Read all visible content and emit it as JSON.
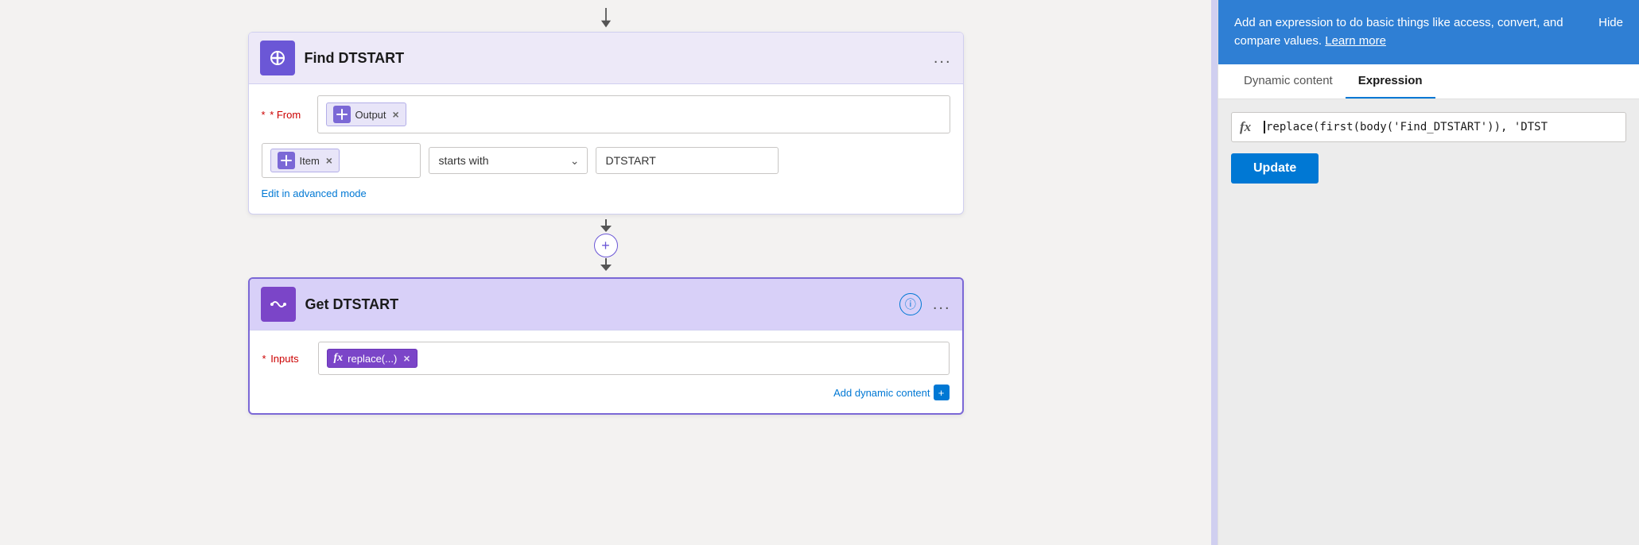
{
  "canvas": {
    "card1": {
      "title": "Find DTSTART",
      "icon": "{/}",
      "from_label": "* From",
      "from_tag": "Output",
      "filter_tag": "Item",
      "filter_operator": "starts with",
      "filter_value": "DTSTART",
      "advanced_link": "Edit in advanced mode",
      "menu": "..."
    },
    "card2": {
      "title": "Get DTSTART",
      "icon": "{/}",
      "inputs_label": "* Inputs",
      "func_tag": "replace(...)",
      "add_dynamic": "Add dynamic content",
      "menu": "..."
    }
  },
  "panel": {
    "info_text": "Add an expression to do basic things like access, convert, and compare values.",
    "learn_more": "Learn more",
    "hide_label": "Hide",
    "tab_dynamic": "Dynamic content",
    "tab_expression": "Expression",
    "fx_label": "fx",
    "expression_value": "replace(first(body('Find_DTSTART')), 'DTST",
    "update_label": "Update"
  }
}
